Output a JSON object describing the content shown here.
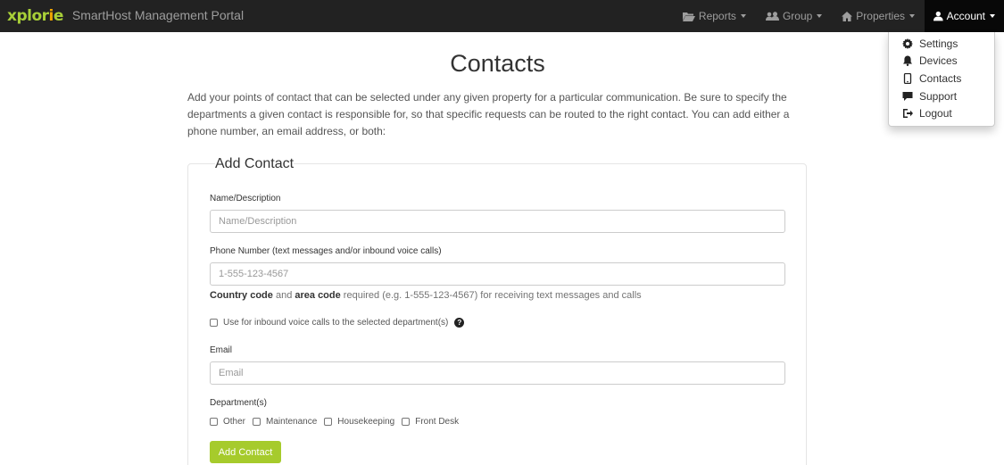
{
  "brand": {
    "logo": "xplorie",
    "title": "SmartHost Management Portal"
  },
  "nav": {
    "reports": "Reports",
    "group": "Group",
    "properties": "Properties",
    "account": "Account"
  },
  "account_menu": {
    "items": [
      "Settings",
      "Devices",
      "Contacts",
      "Support",
      "Logout"
    ]
  },
  "page": {
    "title": "Contacts",
    "intro": "Add your points of contact that can be selected under any given property for a particular communication. Be sure to specify the departments a given contact is responsible for, so that specific requests can be routed to the right contact. You can add either a phone number, an email address, or both:"
  },
  "form": {
    "legend": "Add Contact",
    "name_label": "Name/Description",
    "name_placeholder": "Name/Description",
    "phone_label": "Phone Number (text messages and/or inbound voice calls)",
    "phone_placeholder": "1-555-123-4567",
    "help_country": "Country code",
    "help_and": " and ",
    "help_area": "area code",
    "help_rest": " required (e.g. 1-555-123-4567) for receiving text messages and calls",
    "voice_checkbox_label": "Use for inbound voice calls to the selected department(s)",
    "email_label": "Email",
    "email_placeholder": "Email",
    "departments_label": "Department(s)",
    "departments": [
      "Other",
      "Maintenance",
      "Housekeeping",
      "Front Desk"
    ],
    "submit_label": "Add Contact"
  },
  "colors": {
    "navbar": "#222222",
    "accent": "#a6cb2c"
  }
}
